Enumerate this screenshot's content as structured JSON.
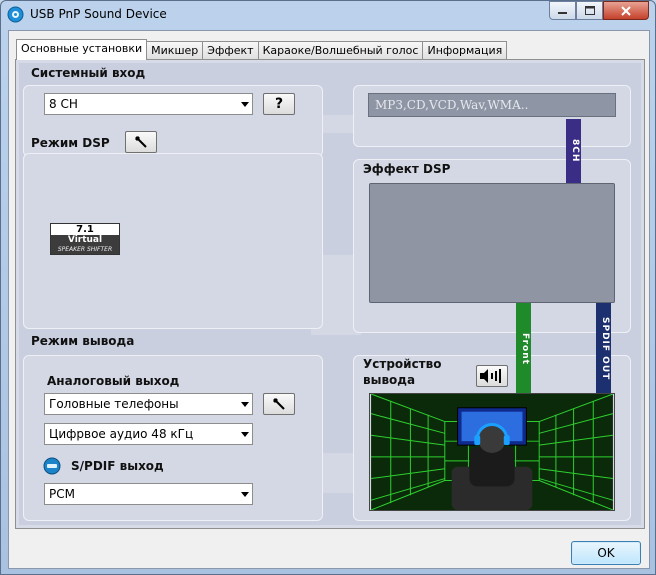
{
  "window": {
    "title": "USB PnP Sound Device"
  },
  "tabs": [
    {
      "label": "Основные установки",
      "active": true
    },
    {
      "label": "Микшер",
      "active": false
    },
    {
      "label": "Эффект",
      "active": false
    },
    {
      "label": "Караоке/Волшебный голос",
      "active": false
    },
    {
      "label": "Информация",
      "active": false
    }
  ],
  "input": {
    "heading": "Системный вход",
    "selected": "8 CH",
    "help_label": "?",
    "sources_text": "MP3,CD,VCD,Wav,WMA.."
  },
  "dsp": {
    "heading": "Режим DSP",
    "badge_line1": "7.1",
    "badge_line2": "Virtual",
    "badge_line3": "SPEAKER SHIFTER",
    "effect_heading": "Эффект DSP"
  },
  "output": {
    "heading": "Режим вывода",
    "analog_heading": "Аналоговый выход",
    "analog_selected": "Головные телефоны",
    "digital_selected": "Цифрвое аудио 48 кГц",
    "spdif_heading": "S/PDIF выход",
    "spdif_selected": "PCM",
    "device_heading_line1": "Устройство",
    "device_heading_line2": "вывода"
  },
  "signal_bars": {
    "ch8": "8CH",
    "front": "Front",
    "spdif": "SPDIF OUT"
  },
  "colors": {
    "ch8_bar": "#3a2d86",
    "front_bar": "#1f8a2a",
    "spdif_bar": "#1c2f6e",
    "scene_grid": "#2fd02f"
  },
  "icons": [
    "sound-device-icon",
    "hammer-icon",
    "speaker-icon",
    "headphones-user-icon"
  ],
  "buttons": {
    "ok": "OK"
  }
}
